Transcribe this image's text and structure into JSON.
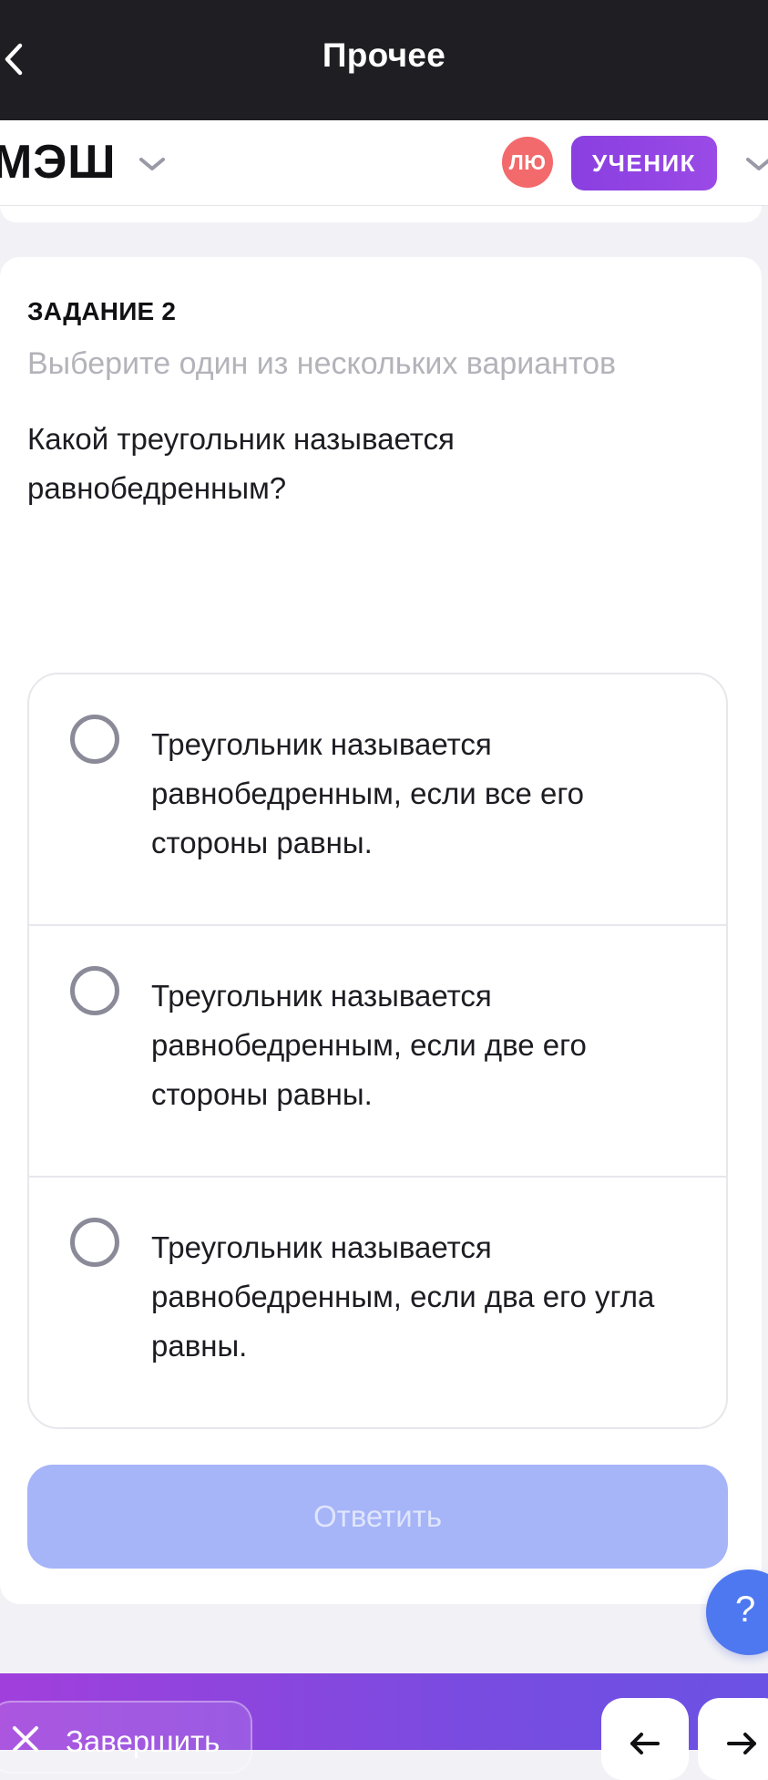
{
  "topbar": {
    "title": "Прочее",
    "back_icon": "chevron-left-icon"
  },
  "header": {
    "logo": "МЭШ",
    "avatar_initials": "ЛЮ",
    "role_badge": "УЧЕНИК",
    "colors": {
      "avatar": "#f26a6c",
      "role_badge": "#8a3fe0"
    }
  },
  "task": {
    "number_label": "ЗАДАНИЕ 2",
    "hint": "Выберите один из нескольких вариантов",
    "question": "Какой треугольник называется равнобедренным?",
    "options": [
      {
        "text": "Треугольник называется равнобедренным, если все его стороны равны.",
        "selected": false
      },
      {
        "text": "Треугольник называется равнобедренным, если две его стороны равны.",
        "selected": false
      },
      {
        "text": "Треугольник называется равнобедренным, если два его угла равны.",
        "selected": false
      }
    ],
    "answer_button": "Ответить",
    "answer_button_color": "#a6b4f8"
  },
  "help_button": {
    "label": "?",
    "color": "#4e78f0"
  },
  "bottombar": {
    "finish_label": "Завершить",
    "finish_icon": "close-icon",
    "prev_icon": "arrow-left-icon",
    "next_icon": "arrow-right-icon"
  }
}
